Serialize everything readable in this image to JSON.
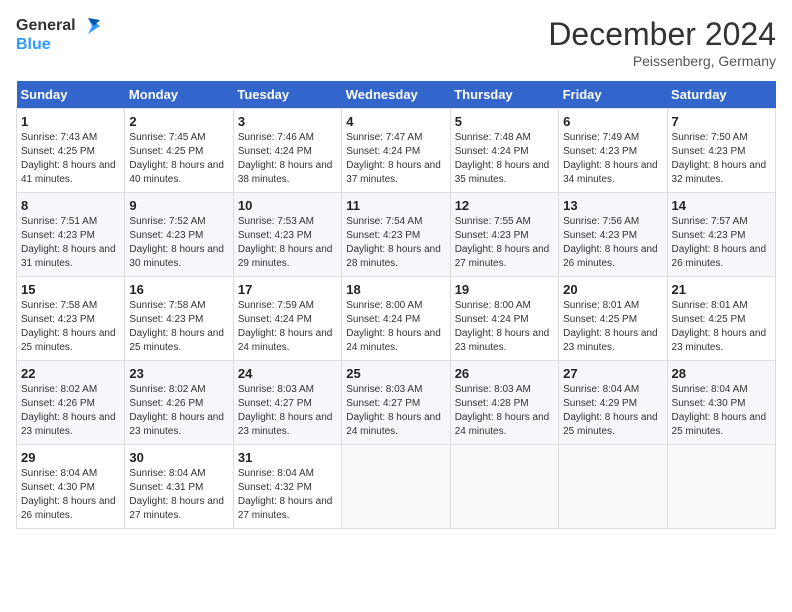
{
  "header": {
    "logo_line1": "General",
    "logo_line2": "Blue",
    "month": "December 2024",
    "location": "Peissenberg, Germany"
  },
  "weekdays": [
    "Sunday",
    "Monday",
    "Tuesday",
    "Wednesday",
    "Thursday",
    "Friday",
    "Saturday"
  ],
  "weeks": [
    [
      {
        "day": "1",
        "sunrise": "Sunrise: 7:43 AM",
        "sunset": "Sunset: 4:25 PM",
        "daylight": "Daylight: 8 hours and 41 minutes."
      },
      {
        "day": "2",
        "sunrise": "Sunrise: 7:45 AM",
        "sunset": "Sunset: 4:25 PM",
        "daylight": "Daylight: 8 hours and 40 minutes."
      },
      {
        "day": "3",
        "sunrise": "Sunrise: 7:46 AM",
        "sunset": "Sunset: 4:24 PM",
        "daylight": "Daylight: 8 hours and 38 minutes."
      },
      {
        "day": "4",
        "sunrise": "Sunrise: 7:47 AM",
        "sunset": "Sunset: 4:24 PM",
        "daylight": "Daylight: 8 hours and 37 minutes."
      },
      {
        "day": "5",
        "sunrise": "Sunrise: 7:48 AM",
        "sunset": "Sunset: 4:24 PM",
        "daylight": "Daylight: 8 hours and 35 minutes."
      },
      {
        "day": "6",
        "sunrise": "Sunrise: 7:49 AM",
        "sunset": "Sunset: 4:23 PM",
        "daylight": "Daylight: 8 hours and 34 minutes."
      },
      {
        "day": "7",
        "sunrise": "Sunrise: 7:50 AM",
        "sunset": "Sunset: 4:23 PM",
        "daylight": "Daylight: 8 hours and 32 minutes."
      }
    ],
    [
      {
        "day": "8",
        "sunrise": "Sunrise: 7:51 AM",
        "sunset": "Sunset: 4:23 PM",
        "daylight": "Daylight: 8 hours and 31 minutes."
      },
      {
        "day": "9",
        "sunrise": "Sunrise: 7:52 AM",
        "sunset": "Sunset: 4:23 PM",
        "daylight": "Daylight: 8 hours and 30 minutes."
      },
      {
        "day": "10",
        "sunrise": "Sunrise: 7:53 AM",
        "sunset": "Sunset: 4:23 PM",
        "daylight": "Daylight: 8 hours and 29 minutes."
      },
      {
        "day": "11",
        "sunrise": "Sunrise: 7:54 AM",
        "sunset": "Sunset: 4:23 PM",
        "daylight": "Daylight: 8 hours and 28 minutes."
      },
      {
        "day": "12",
        "sunrise": "Sunrise: 7:55 AM",
        "sunset": "Sunset: 4:23 PM",
        "daylight": "Daylight: 8 hours and 27 minutes."
      },
      {
        "day": "13",
        "sunrise": "Sunrise: 7:56 AM",
        "sunset": "Sunset: 4:23 PM",
        "daylight": "Daylight: 8 hours and 26 minutes."
      },
      {
        "day": "14",
        "sunrise": "Sunrise: 7:57 AM",
        "sunset": "Sunset: 4:23 PM",
        "daylight": "Daylight: 8 hours and 26 minutes."
      }
    ],
    [
      {
        "day": "15",
        "sunrise": "Sunrise: 7:58 AM",
        "sunset": "Sunset: 4:23 PM",
        "daylight": "Daylight: 8 hours and 25 minutes."
      },
      {
        "day": "16",
        "sunrise": "Sunrise: 7:58 AM",
        "sunset": "Sunset: 4:23 PM",
        "daylight": "Daylight: 8 hours and 25 minutes."
      },
      {
        "day": "17",
        "sunrise": "Sunrise: 7:59 AM",
        "sunset": "Sunset: 4:24 PM",
        "daylight": "Daylight: 8 hours and 24 minutes."
      },
      {
        "day": "18",
        "sunrise": "Sunrise: 8:00 AM",
        "sunset": "Sunset: 4:24 PM",
        "daylight": "Daylight: 8 hours and 24 minutes."
      },
      {
        "day": "19",
        "sunrise": "Sunrise: 8:00 AM",
        "sunset": "Sunset: 4:24 PM",
        "daylight": "Daylight: 8 hours and 23 minutes."
      },
      {
        "day": "20",
        "sunrise": "Sunrise: 8:01 AM",
        "sunset": "Sunset: 4:25 PM",
        "daylight": "Daylight: 8 hours and 23 minutes."
      },
      {
        "day": "21",
        "sunrise": "Sunrise: 8:01 AM",
        "sunset": "Sunset: 4:25 PM",
        "daylight": "Daylight: 8 hours and 23 minutes."
      }
    ],
    [
      {
        "day": "22",
        "sunrise": "Sunrise: 8:02 AM",
        "sunset": "Sunset: 4:26 PM",
        "daylight": "Daylight: 8 hours and 23 minutes."
      },
      {
        "day": "23",
        "sunrise": "Sunrise: 8:02 AM",
        "sunset": "Sunset: 4:26 PM",
        "daylight": "Daylight: 8 hours and 23 minutes."
      },
      {
        "day": "24",
        "sunrise": "Sunrise: 8:03 AM",
        "sunset": "Sunset: 4:27 PM",
        "daylight": "Daylight: 8 hours and 23 minutes."
      },
      {
        "day": "25",
        "sunrise": "Sunrise: 8:03 AM",
        "sunset": "Sunset: 4:27 PM",
        "daylight": "Daylight: 8 hours and 24 minutes."
      },
      {
        "day": "26",
        "sunrise": "Sunrise: 8:03 AM",
        "sunset": "Sunset: 4:28 PM",
        "daylight": "Daylight: 8 hours and 24 minutes."
      },
      {
        "day": "27",
        "sunrise": "Sunrise: 8:04 AM",
        "sunset": "Sunset: 4:29 PM",
        "daylight": "Daylight: 8 hours and 25 minutes."
      },
      {
        "day": "28",
        "sunrise": "Sunrise: 8:04 AM",
        "sunset": "Sunset: 4:30 PM",
        "daylight": "Daylight: 8 hours and 25 minutes."
      }
    ],
    [
      {
        "day": "29",
        "sunrise": "Sunrise: 8:04 AM",
        "sunset": "Sunset: 4:30 PM",
        "daylight": "Daylight: 8 hours and 26 minutes."
      },
      {
        "day": "30",
        "sunrise": "Sunrise: 8:04 AM",
        "sunset": "Sunset: 4:31 PM",
        "daylight": "Daylight: 8 hours and 27 minutes."
      },
      {
        "day": "31",
        "sunrise": "Sunrise: 8:04 AM",
        "sunset": "Sunset: 4:32 PM",
        "daylight": "Daylight: 8 hours and 27 minutes."
      },
      null,
      null,
      null,
      null
    ]
  ]
}
